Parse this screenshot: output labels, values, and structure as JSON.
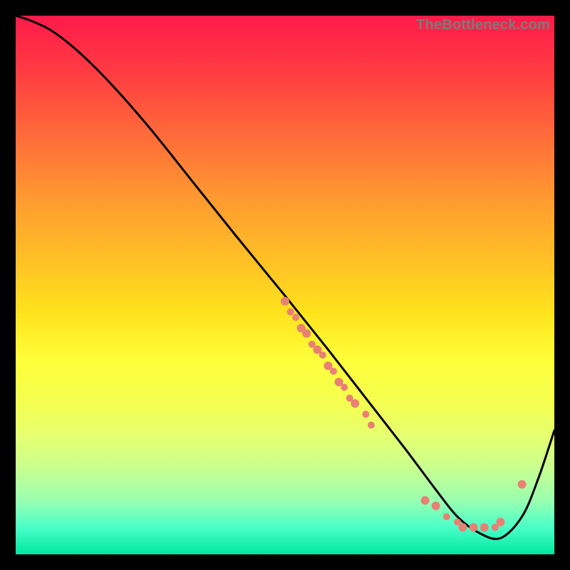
{
  "watermark": "TheBottleneck.com",
  "colors": {
    "background": "#000000",
    "curve": "#000000",
    "dots": "#e98074",
    "gradient_top": "#ff1a4a",
    "gradient_bottom": "#00e8a0"
  },
  "chart_data": {
    "type": "line",
    "title": "",
    "xlabel": "",
    "ylabel": "",
    "xlim": [
      0,
      100
    ],
    "ylim": [
      0,
      100
    ],
    "grid": false,
    "legend": false,
    "series": [
      {
        "name": "bottleneck-curve",
        "x": [
          0,
          3,
          7,
          12,
          18,
          25,
          33,
          41,
          50,
          58,
          65,
          72,
          78,
          82,
          86,
          90,
          94,
          97,
          100
        ],
        "y": [
          100,
          99,
          97,
          93,
          87,
          79,
          69,
          59,
          48,
          38,
          29,
          20,
          12,
          7,
          4,
          3,
          7,
          14,
          23
        ]
      }
    ],
    "points": [
      {
        "name": "cluster-mid-1",
        "x": 50,
        "y": 47,
        "r": 6
      },
      {
        "name": "cluster-mid-2",
        "x": 51,
        "y": 45,
        "r": 5
      },
      {
        "name": "cluster-mid-3",
        "x": 52,
        "y": 44,
        "r": 5
      },
      {
        "name": "cluster-mid-4",
        "x": 53,
        "y": 42,
        "r": 6
      },
      {
        "name": "cluster-mid-5",
        "x": 54,
        "y": 41,
        "r": 6
      },
      {
        "name": "cluster-mid-6",
        "x": 55,
        "y": 39,
        "r": 5
      },
      {
        "name": "cluster-mid-7",
        "x": 56,
        "y": 38,
        "r": 6
      },
      {
        "name": "cluster-mid-8",
        "x": 57,
        "y": 37,
        "r": 5
      },
      {
        "name": "cluster-mid-9",
        "x": 58,
        "y": 35,
        "r": 6
      },
      {
        "name": "cluster-mid-10",
        "x": 59,
        "y": 34,
        "r": 5
      },
      {
        "name": "cluster-mid-11",
        "x": 60,
        "y": 32,
        "r": 6
      },
      {
        "name": "cluster-mid-12",
        "x": 61,
        "y": 31,
        "r": 5
      },
      {
        "name": "cluster-mid-13",
        "x": 62,
        "y": 29,
        "r": 5
      },
      {
        "name": "cluster-mid-14",
        "x": 63,
        "y": 28,
        "r": 6
      },
      {
        "name": "cluster-mid-15",
        "x": 65,
        "y": 26,
        "r": 5
      },
      {
        "name": "cluster-mid-16",
        "x": 66,
        "y": 24,
        "r": 5
      },
      {
        "name": "cluster-low-1",
        "x": 76,
        "y": 10,
        "r": 6
      },
      {
        "name": "cluster-low-2",
        "x": 78,
        "y": 9,
        "r": 6
      },
      {
        "name": "cluster-low-3",
        "x": 80,
        "y": 7,
        "r": 5
      },
      {
        "name": "cluster-low-4",
        "x": 82,
        "y": 6,
        "r": 5
      },
      {
        "name": "cluster-low-5",
        "x": 83,
        "y": 5,
        "r": 6
      },
      {
        "name": "cluster-low-6",
        "x": 85,
        "y": 5,
        "r": 6
      },
      {
        "name": "cluster-low-7",
        "x": 87,
        "y": 5,
        "r": 6
      },
      {
        "name": "cluster-low-8",
        "x": 89,
        "y": 5,
        "r": 5
      },
      {
        "name": "cluster-low-9",
        "x": 90,
        "y": 6,
        "r": 6
      },
      {
        "name": "cluster-upturn-1",
        "x": 94,
        "y": 13,
        "r": 6
      }
    ]
  }
}
